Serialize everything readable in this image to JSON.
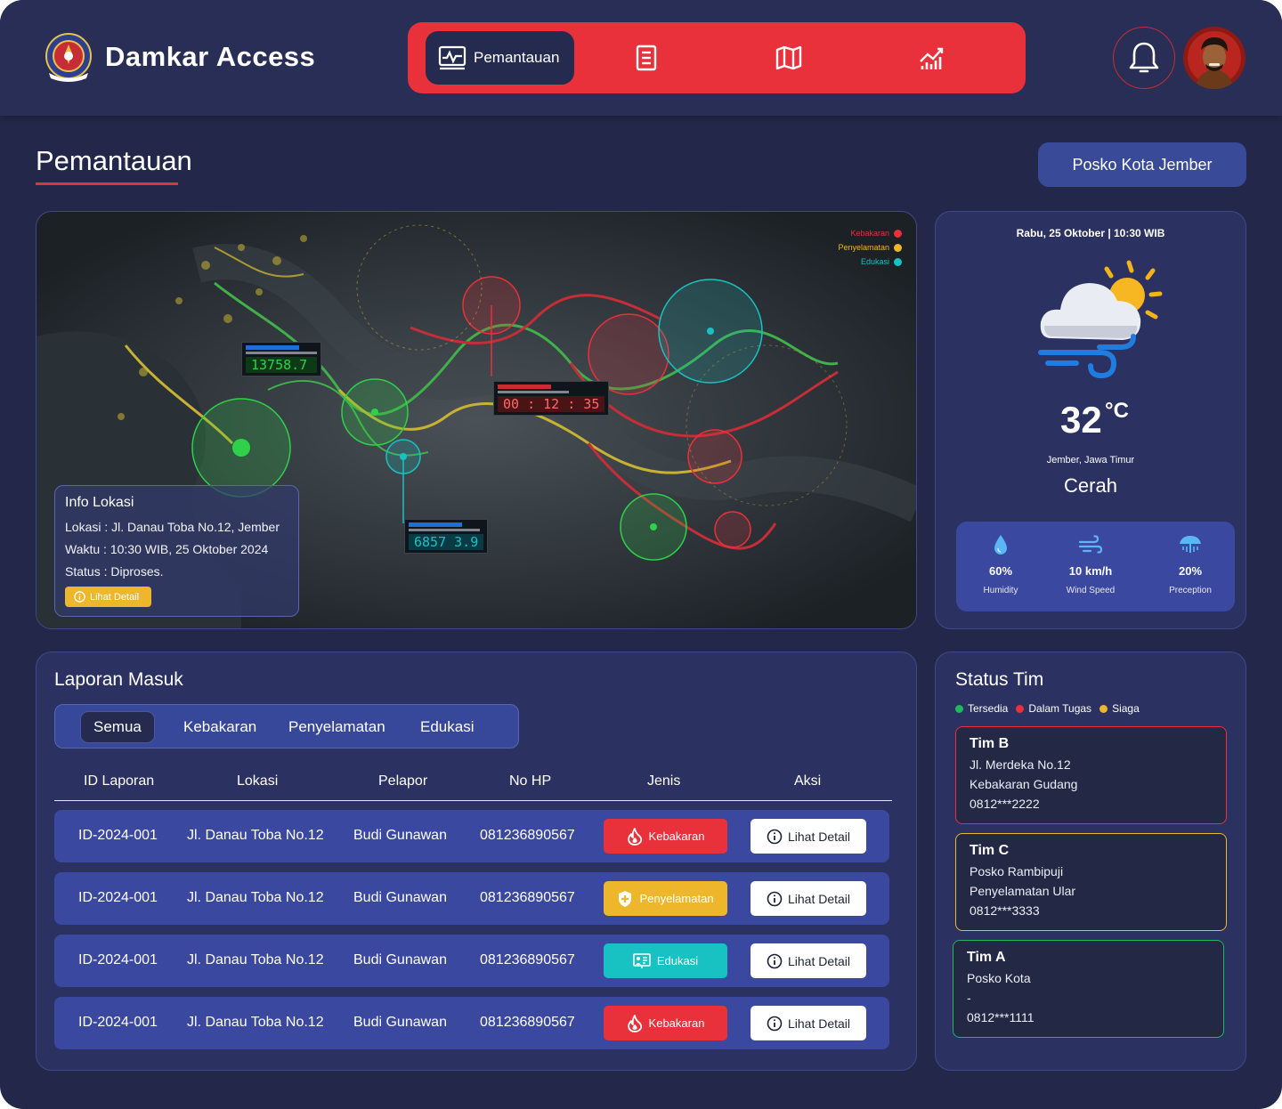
{
  "header": {
    "app_title": "Damkar Access",
    "nav": [
      {
        "label": "Pemantauan",
        "icon": "monitor-chart-icon",
        "active": true
      },
      {
        "label": "",
        "icon": "document-icon",
        "active": false
      },
      {
        "label": "",
        "icon": "map-icon",
        "active": false
      },
      {
        "label": "",
        "icon": "analytics-icon",
        "active": false
      }
    ],
    "notification_icon": "bell-icon",
    "accent_color": "#e8313a"
  },
  "page": {
    "title": "Pemantauan",
    "posko_button": "Posko Kota Jember"
  },
  "map": {
    "legend": [
      {
        "label": "Kebakaran",
        "color": "#e8313a"
      },
      {
        "label": "Penyelamatan",
        "color": "#eeb72b"
      },
      {
        "label": "Edukasi",
        "color": "#19c2c2"
      }
    ],
    "sensor_values": [
      "13758.7",
      "00 : 12 : 35",
      "6857 3.9"
    ],
    "info": {
      "title": "Info Lokasi",
      "lokasi": "Lokasi : Jl. Danau Toba No.12, Jember",
      "waktu": "Waktu : 10:30 WIB, 25 Oktober 2024",
      "status": "Status : Diproses.",
      "button": "Lihat Detail"
    }
  },
  "weather": {
    "date": "Rabu, 25 Oktober | 10:30 WIB",
    "temperature": "32",
    "unit": "°C",
    "location": "Jember, Jawa Timur",
    "condition": "Cerah",
    "stats": [
      {
        "value": "60%",
        "label": "Humidity",
        "icon": "water-drop-icon"
      },
      {
        "value": "10 km/h",
        "label": "Wind Speed",
        "icon": "wind-icon"
      },
      {
        "value": "20%",
        "label": "Preception",
        "icon": "umbrella-rain-icon"
      }
    ]
  },
  "reports": {
    "title": "Laporan Masuk",
    "filters": [
      "Semua",
      "Kebakaran",
      "Penyelamatan",
      "Edukasi"
    ],
    "active_filter": "Semua",
    "columns": [
      "ID Laporan",
      "Lokasi",
      "Pelapor",
      "No HP",
      "Jenis",
      "Aksi"
    ],
    "rows": [
      {
        "id": "ID-2024-001",
        "lokasi": "Jl. Danau Toba No.12",
        "pelapor": "Budi Gunawan",
        "hp": "081236890567",
        "jenis": "Kebakaran",
        "jenis_color": "#e8313a",
        "jenis_icon": "fire-icon",
        "aksi": "Lihat Detail"
      },
      {
        "id": "ID-2024-001",
        "lokasi": "Jl. Danau Toba No.12",
        "pelapor": "Budi Gunawan",
        "hp": "081236890567",
        "jenis": "Penyelamatan",
        "jenis_color": "#eeb72b",
        "jenis_icon": "shield-icon",
        "aksi": "Lihat Detail"
      },
      {
        "id": "ID-2024-001",
        "lokasi": "Jl. Danau Toba No.12",
        "pelapor": "Budi Gunawan",
        "hp": "081236890567",
        "jenis": "Edukasi",
        "jenis_color": "#19c2c2",
        "jenis_icon": "presentation-icon",
        "aksi": "Lihat Detail"
      },
      {
        "id": "ID-2024-001",
        "lokasi": "Jl. Danau Toba No.12",
        "pelapor": "Budi Gunawan",
        "hp": "081236890567",
        "jenis": "Kebakaran",
        "jenis_color": "#e8313a",
        "jenis_icon": "fire-icon",
        "aksi": "Lihat Detail"
      }
    ]
  },
  "teams": {
    "title": "Status Tim",
    "legend": [
      {
        "label": "Tersedia",
        "color": "#1fb85a"
      },
      {
        "label": "Dalam Tugas",
        "color": "#e8313a"
      },
      {
        "label": "Siaga",
        "color": "#eeb72b"
      }
    ],
    "cards": [
      {
        "name": "Tim B",
        "lines": [
          "Jl. Merdeka No.12",
          "Kebakaran Gudang",
          "0812***2222"
        ],
        "border": "#e8313a"
      },
      {
        "name": "Tim C",
        "lines": [
          "Posko Rambipuji",
          "Penyelamatan Ular",
          "0812***3333"
        ],
        "border": "#eeb72b"
      },
      {
        "name": "Tim A",
        "lines": [
          "Posko Kota",
          "-",
          "0812***1111"
        ],
        "border": "#1fb85a"
      }
    ]
  }
}
